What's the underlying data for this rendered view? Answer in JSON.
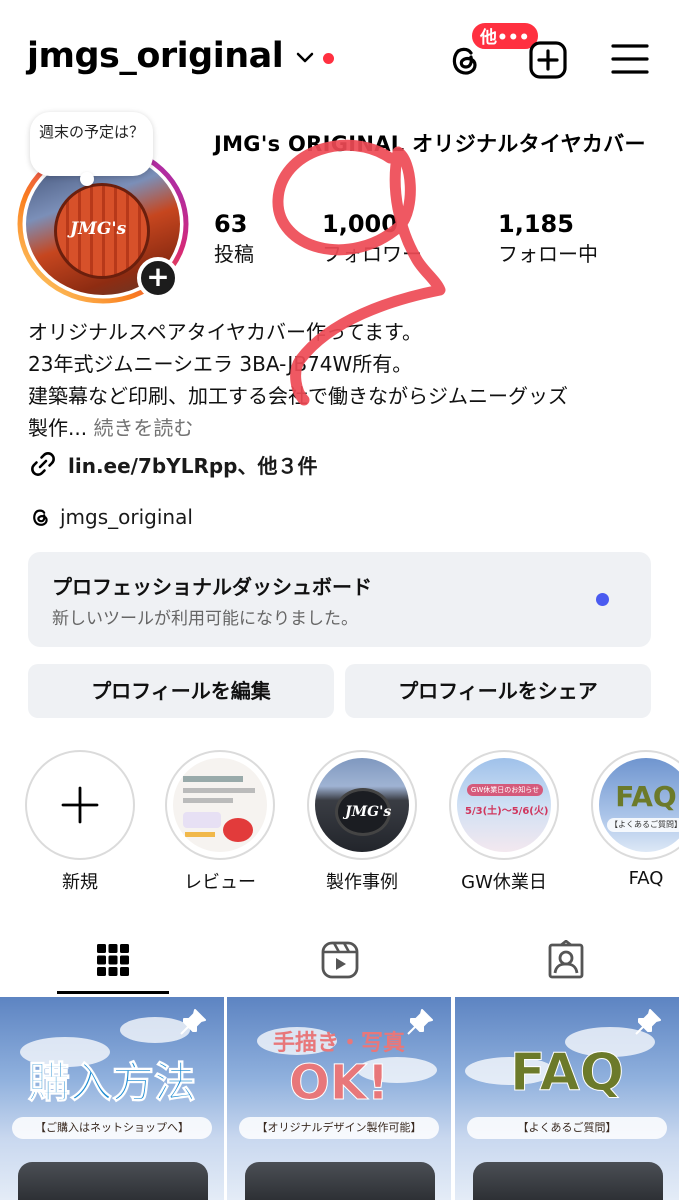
{
  "header": {
    "username": "jmgs_original",
    "notification_badge": "他•••",
    "icons": {
      "threads": "threads-icon",
      "add": "add-content-icon",
      "menu": "hamburger-menu-icon",
      "dropdown": "chevron-down-icon"
    },
    "accent_red": "#ff3040"
  },
  "profile": {
    "note": "週末の予定は？",
    "display_name": "JMG's ORIGINAL オリジナルタイヤカバー",
    "stats": [
      {
        "value": "63",
        "label": "投稿"
      },
      {
        "value": "1,000",
        "label": "フォロワー"
      },
      {
        "value": "1,185",
        "label": "フォロー中"
      }
    ],
    "bio_lines": [
      "オリジナルスペアタイヤカバー作ってます。",
      "23年式ジムニーシエラ 3BA-JB74W所有。",
      "建築幕など印刷、加工する会社で働きながらジムニーグッズ"
    ],
    "bio_last": "製作...",
    "bio_more": "続きを読む",
    "link": "lin.ee/7bYLRpp、他３件",
    "threads_handle": "jmgs_original"
  },
  "dashboard": {
    "title": "プロフェッショナルダッシュボード",
    "subtitle": "新しいツールが利用可能になりました。",
    "dot_color": "#4a5bf0"
  },
  "buttons": {
    "edit_profile": "プロフィールを編集",
    "share_profile": "プロフィールをシェア"
  },
  "highlights": [
    {
      "label": "新規"
    },
    {
      "label": "レビュー"
    },
    {
      "label": "製作事例"
    },
    {
      "label": "GW休業日"
    },
    {
      "label": "FAQ"
    }
  ],
  "highlight_art": {
    "faq_text": "FAQ",
    "faq_sub": "【よくあるご質問】",
    "gw_title": "GW休業日のお知らせ",
    "gw_dates": "5/3(土)〜5/6(火)",
    "jmgs_logo": "JMG's"
  },
  "tabs": [
    {
      "icon": "grid-icon"
    },
    {
      "icon": "reels-icon"
    },
    {
      "icon": "tagged-icon"
    }
  ],
  "posts": [
    {
      "title": "購入方法",
      "sub": "【ご購入はネットショップへ】",
      "title_color": "#1e8bd1"
    },
    {
      "title_top": "手描き・写真",
      "title": "OK!",
      "sub": "【オリジナルデザイン製作可能】",
      "title_color": "#e8777a"
    },
    {
      "title": "FAQ",
      "sub": "【よくあるご質問】",
      "title_color": "#6c7a2a"
    }
  ]
}
